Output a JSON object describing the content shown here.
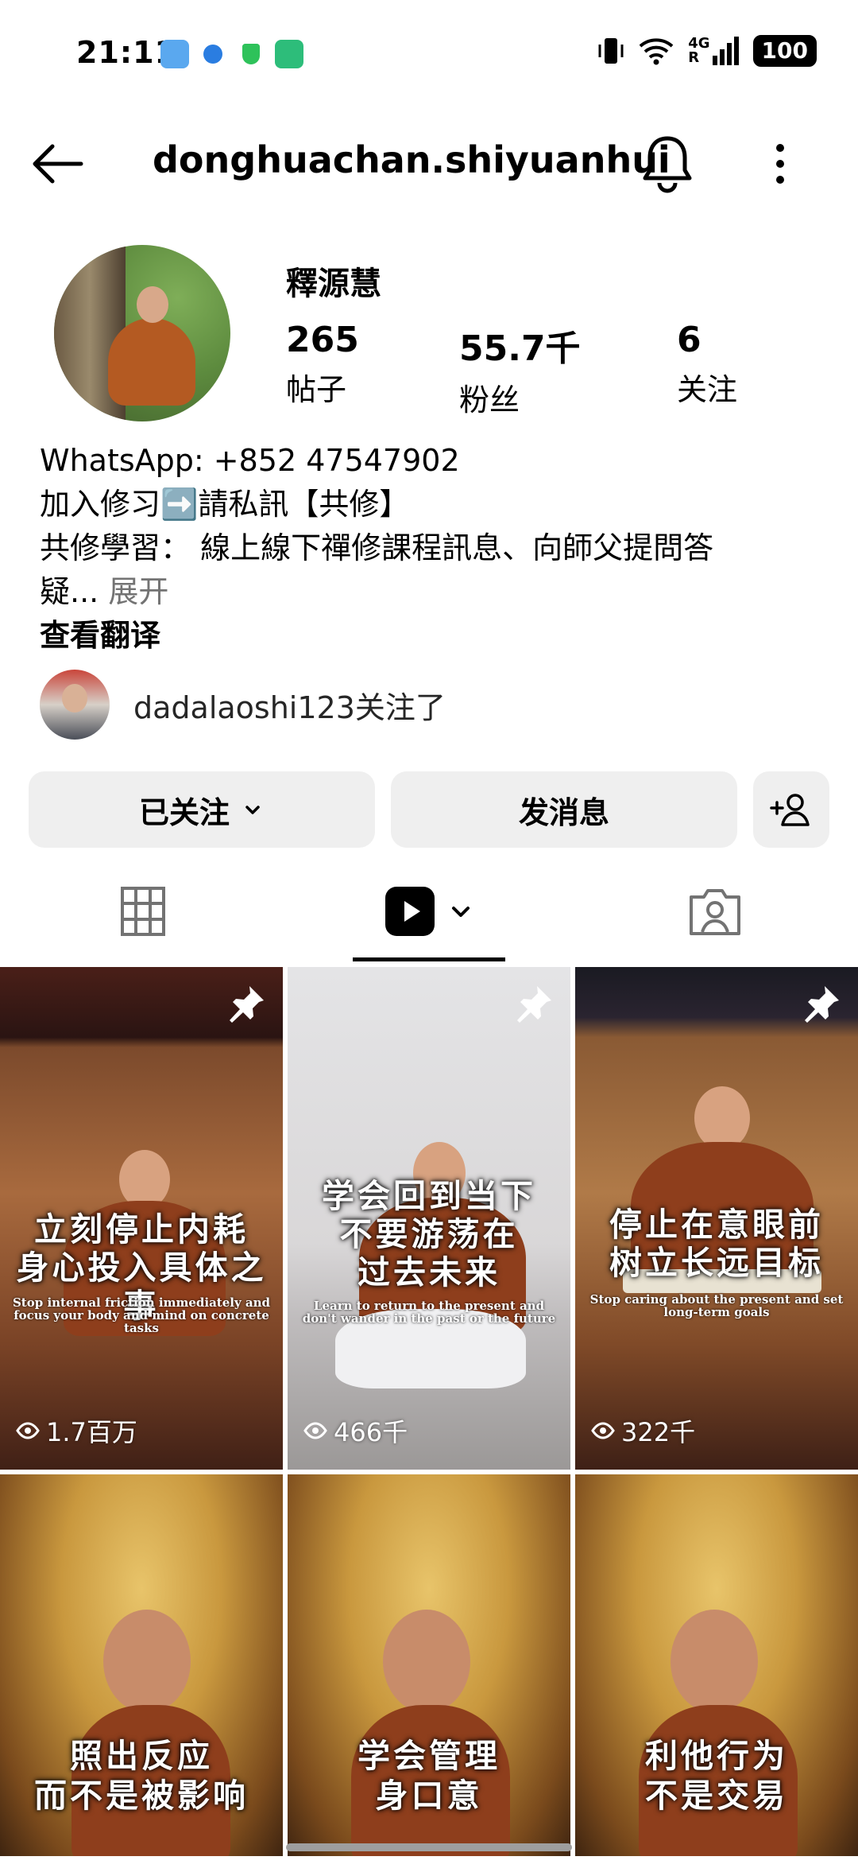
{
  "status_bar": {
    "time": "21:11",
    "network": "4G",
    "roaming": "R",
    "battery": "100"
  },
  "header": {
    "username": "donghuachan.shiyuanhui"
  },
  "profile": {
    "display_name": "釋源慧",
    "stats": [
      {
        "value": "265",
        "label": "帖子"
      },
      {
        "value": "55.7千",
        "label": "粉丝"
      },
      {
        "value": "6",
        "label": "关注"
      }
    ],
    "bio": {
      "line1": "WhatsApp: +852 47547902",
      "line2": "加入修习➡️請私訊【共修】",
      "line3": "共修學習： 線上線下禪修課程訊息、向師父提問答",
      "line4": "疑...",
      "more": "展开",
      "see_translation": "查看翻译"
    },
    "followed_by": "dadalaoshi123关注了"
  },
  "actions": {
    "following": "已关注",
    "message": "发消息"
  },
  "grid": [
    {
      "caption1": "立刻停止内耗",
      "caption2": "身心投入具体之事",
      "sub": "Stop internal friction immediately and focus your body and mind on concrete tasks",
      "views": "1.7百万",
      "pinned": true
    },
    {
      "caption1": "学会回到当下",
      "caption2": "不要游荡在",
      "caption3": "过去未来",
      "sub": "Learn to return to the present and don't wander in the past or the future",
      "views": "466千",
      "pinned": true
    },
    {
      "caption1": "停止在意眼前",
      "caption2": "树立长远目标",
      "sub": "Stop caring about the present and set long-term goals",
      "views": "322千",
      "pinned": true
    },
    {
      "caption1": "照出反应",
      "caption2": "而不是被影响"
    },
    {
      "caption1": "学会管理",
      "caption2": "身口意"
    },
    {
      "caption1": "利他行为",
      "caption2": "不是交易"
    }
  ],
  "colors": {
    "button_bg": "#efefef",
    "muted_text": "#737373",
    "robe": "#8e3e1c"
  }
}
